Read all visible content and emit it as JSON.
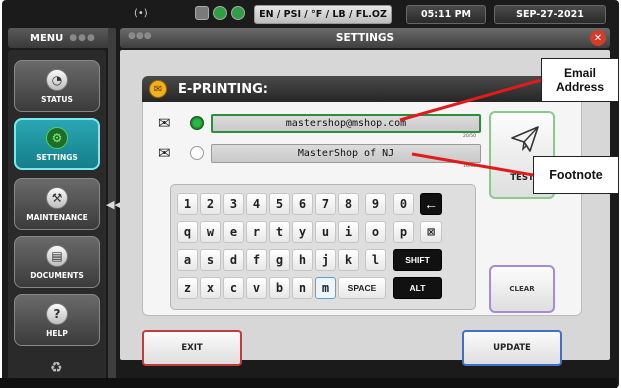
{
  "statusbar": {
    "signal": "(•)",
    "units": "EN / PSI / °F / LB / FL.OZ",
    "time": "05:11 PM",
    "date": "SEP-27-2021"
  },
  "menu": {
    "label": "MENU",
    "items": [
      {
        "label": "STATUS",
        "icon": "status-icon",
        "glyph": "◔"
      },
      {
        "label": "SETTINGS",
        "icon": "gear-icon",
        "glyph": "⚙"
      },
      {
        "label": "MAINTENANCE",
        "icon": "tools-icon",
        "glyph": "⚒"
      },
      {
        "label": "DOCUMENTS",
        "icon": "document-icon",
        "glyph": "▤"
      },
      {
        "label": "HELP",
        "icon": "help-icon",
        "glyph": "?"
      }
    ],
    "active": "SETTINGS"
  },
  "window": {
    "title": "SETTINGS"
  },
  "eprinting": {
    "title": "E-PRINTING:",
    "email": {
      "value": "mastershop@mshop.com",
      "count": "20/50"
    },
    "footnote": {
      "value": "MasterShop of NJ",
      "count": "16/50"
    },
    "test_label": "TEST",
    "clear_label": "CLEAR"
  },
  "keyboard": {
    "row1": [
      "1",
      "2",
      "3",
      "4",
      "5",
      "6",
      "7",
      "8",
      "9",
      "0"
    ],
    "row2": [
      "q",
      "w",
      "e",
      "r",
      "t",
      "y",
      "u",
      "i",
      "o",
      "p"
    ],
    "row3": [
      "a",
      "s",
      "d",
      "f",
      "g",
      "h",
      "j",
      "k",
      "l"
    ],
    "row4": [
      "z",
      "x",
      "c",
      "v",
      "b",
      "n",
      "m"
    ],
    "backspace": "🢐",
    "delete": "⊠",
    "shift": "SHIFT",
    "space": "SPACE",
    "alt": "ALT"
  },
  "actions": {
    "exit": "EXIT",
    "update": "UPDATE"
  },
  "callouts": {
    "email": "Email Address",
    "footnote": "Footnote"
  },
  "colors": {
    "accent_teal": "#2aa6b3",
    "active_green": "#2c8f3e",
    "exit_red": "#c43b3b",
    "update_blue": "#4070c8",
    "callout_line": "#e11b1b"
  }
}
